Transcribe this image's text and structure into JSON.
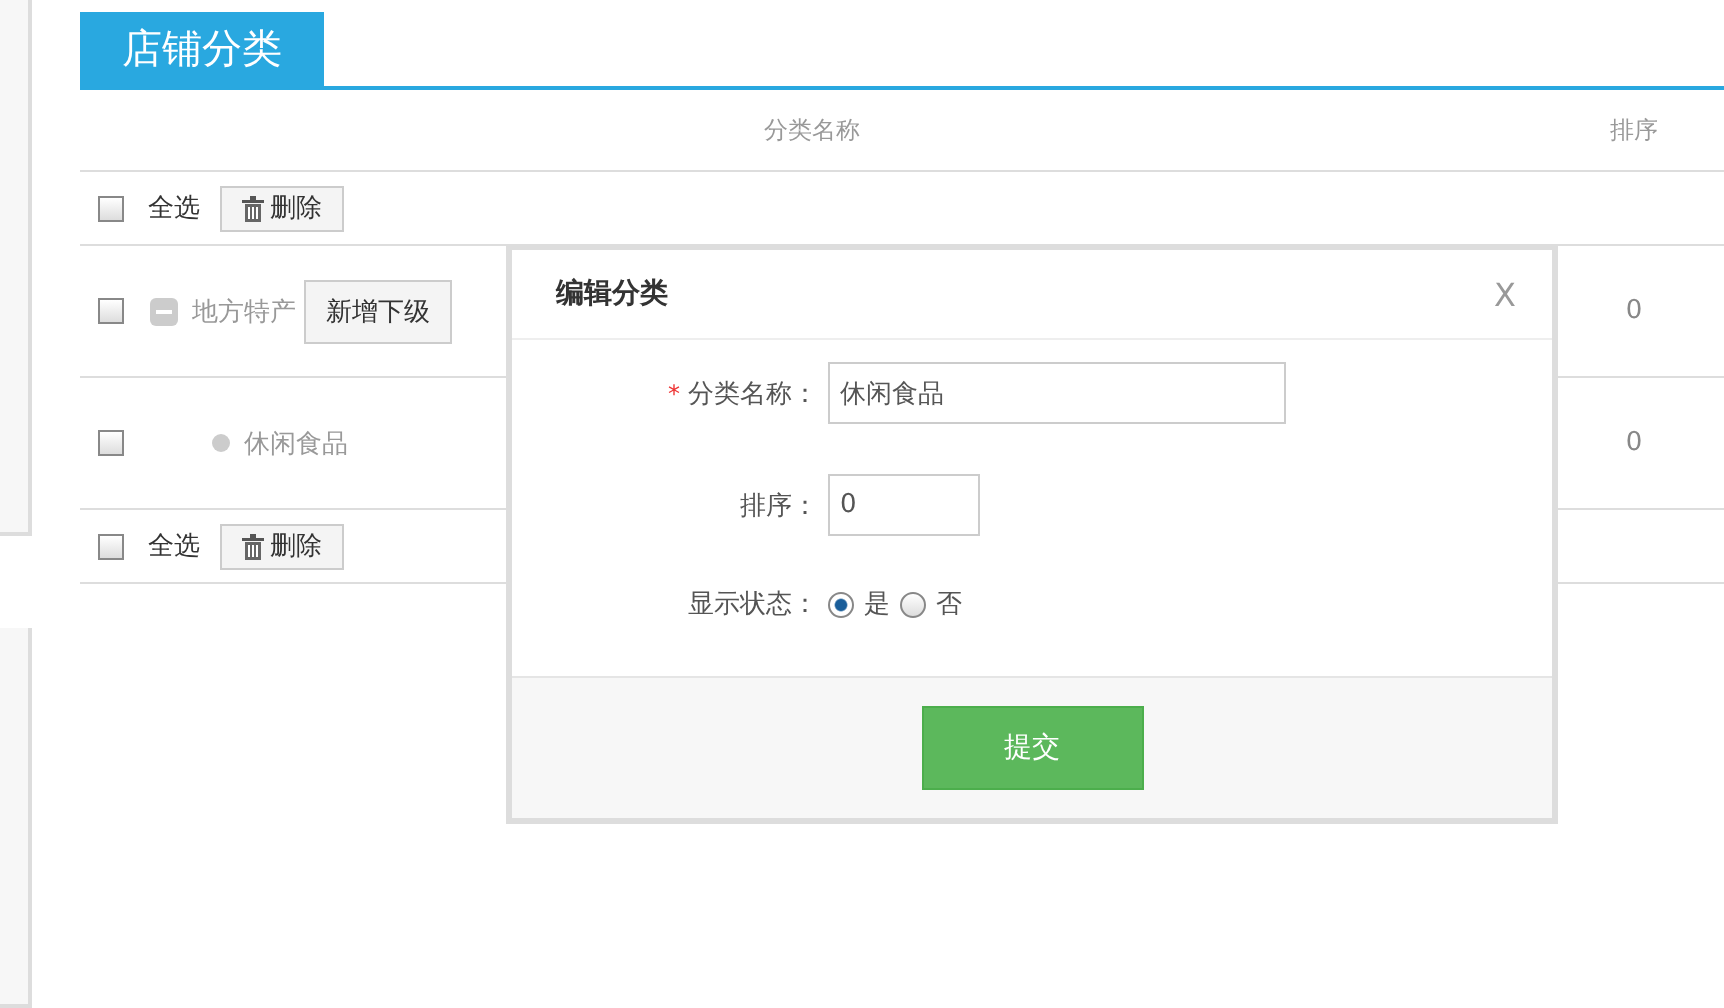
{
  "header": {
    "title": "店铺分类"
  },
  "table": {
    "columns": [
      "分类名称",
      "排序"
    ],
    "toolbar_top": {
      "select_all": "全选",
      "checked": false,
      "delete": "删除"
    },
    "rows": [
      {
        "kind": "parent",
        "checked": false,
        "expanded": true,
        "name": "地方特产",
        "action": "新增下级",
        "sort": "0"
      },
      {
        "kind": "child",
        "checked": false,
        "name": "休闲食品",
        "sort": "0"
      }
    ],
    "toolbar_bottom": {
      "select_all": "全选",
      "checked": false,
      "delete": "删除"
    }
  },
  "dialog": {
    "title": "编辑分类",
    "close": "X",
    "fields": [
      {
        "kind": "text",
        "required": true,
        "required_mark": "*",
        "label": "分类名称：",
        "value": "休闲食品"
      },
      {
        "kind": "short",
        "required": false,
        "label": "排序：",
        "value": "0"
      },
      {
        "kind": "radio",
        "required": false,
        "label": "显示状态：",
        "options": [
          {
            "label": "是",
            "selected": true
          },
          {
            "label": "否",
            "selected": false
          }
        ]
      }
    ],
    "submit": "提交"
  }
}
